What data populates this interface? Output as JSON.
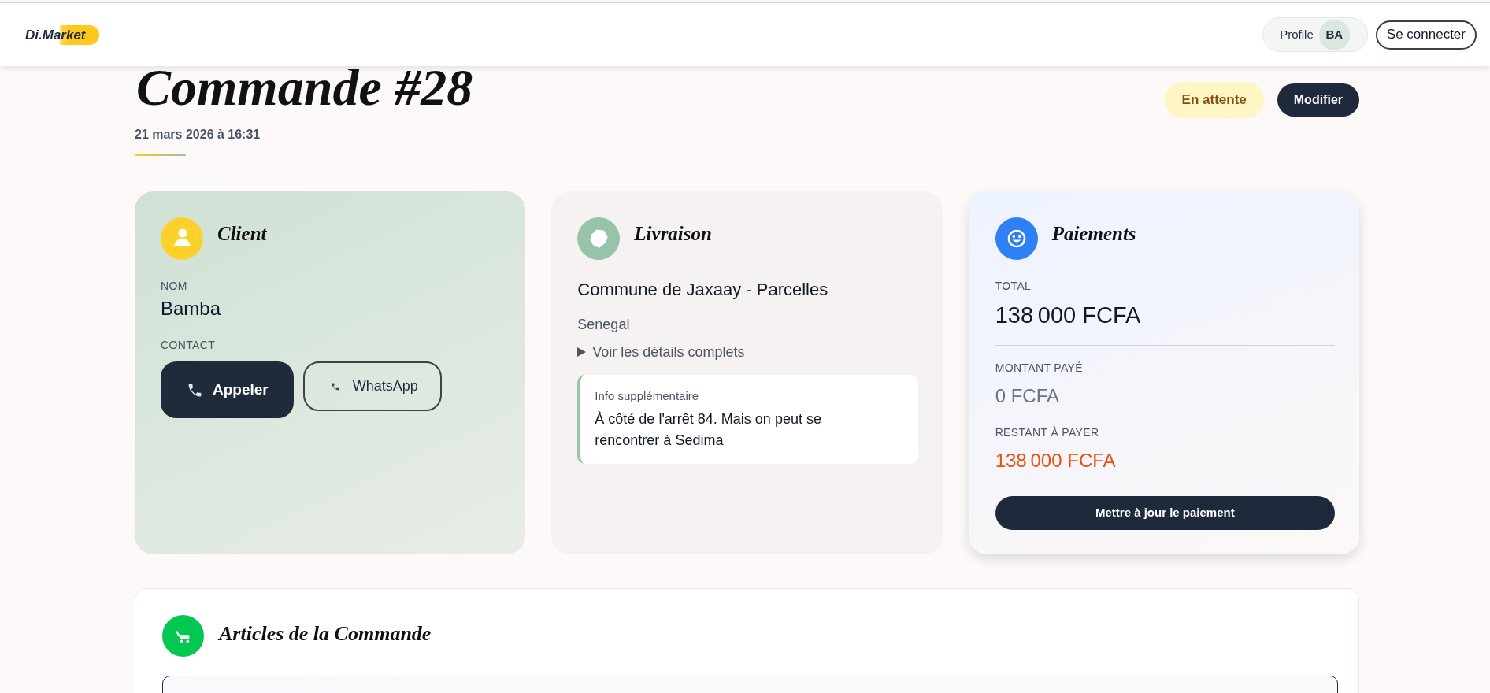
{
  "header": {
    "logo": "Di.Market",
    "profile": {
      "label": "Profile",
      "initials": "BA"
    },
    "login_button": "Se connecter"
  },
  "order": {
    "title": "Commande #28",
    "date": "21 mars 2026 à 16:31",
    "status": {
      "label": "En attente",
      "kind": "pending"
    },
    "edit_button": "Modifier"
  },
  "client": {
    "title": "Client",
    "name_label": "NOM",
    "name": "Bamba",
    "contact_label": "CONTACT",
    "actions": [
      {
        "label": "Appeler",
        "kind": "primary"
      },
      {
        "label": "WhatsApp",
        "kind": "outline"
      }
    ]
  },
  "delivery": {
    "title": "Livraison",
    "address": "Commune de Jaxaay - Parcelles",
    "country": "Senegal",
    "details_toggle": {
      "label": "Voir les détails complets",
      "expanded": false
    },
    "note": {
      "label": "Info supplémentaire",
      "text": "À côté de l'arrêt 84. Mais on peut se rencontrer à Sedima"
    }
  },
  "payments": {
    "title": "Paiements",
    "lines": [
      {
        "kind": "total",
        "label": "TOTAL",
        "amount": "138 000 FCFA"
      },
      {
        "kind": "paid",
        "label": "MONTANT PAYÉ",
        "amount": "0 FCFA"
      },
      {
        "kind": "remaining",
        "label": "RESTANT À PAYER",
        "amount": "138 000 FCFA"
      }
    ],
    "update_button": "Mettre à jour le paiement"
  },
  "articles": {
    "title": "Articles de la Commande"
  }
}
